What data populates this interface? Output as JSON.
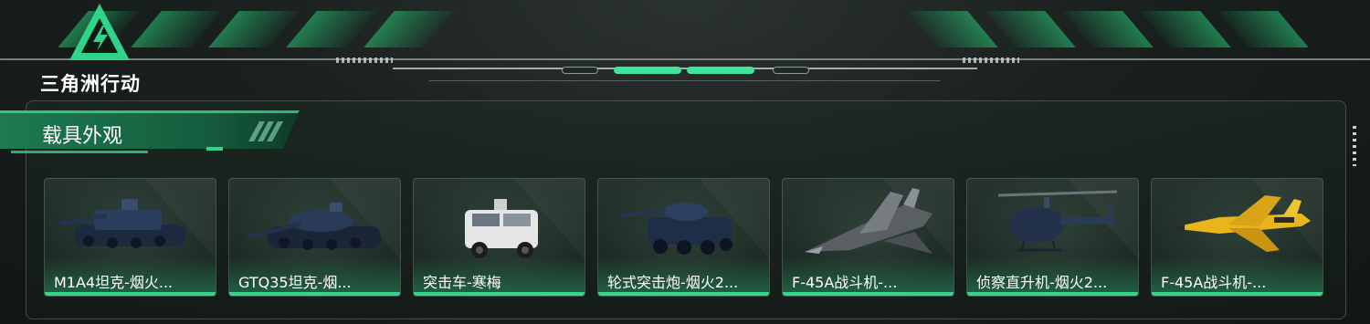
{
  "brand": {
    "logo_text": "三角洲行动",
    "logo_icon": "delta-triangle-bolt-icon",
    "accent_color": "#3ee59a"
  },
  "section": {
    "title": "载具外观"
  },
  "vehicles": [
    {
      "name": "M1A4坦克-烟火...",
      "icon": "tank-icon"
    },
    {
      "name": "GTQ35坦克-烟...",
      "icon": "tank-icon"
    },
    {
      "name": "突击车-寒梅",
      "icon": "armored-car-icon"
    },
    {
      "name": "轮式突击炮-烟火2...",
      "icon": "wheeled-assault-gun-icon"
    },
    {
      "name": "F-45A战斗机-...",
      "icon": "fighter-jet-icon"
    },
    {
      "name": "侦察直升机-烟火2...",
      "icon": "helicopter-icon"
    },
    {
      "name": "F-45A战斗机-...",
      "icon": "fighter-jet-icon"
    }
  ]
}
